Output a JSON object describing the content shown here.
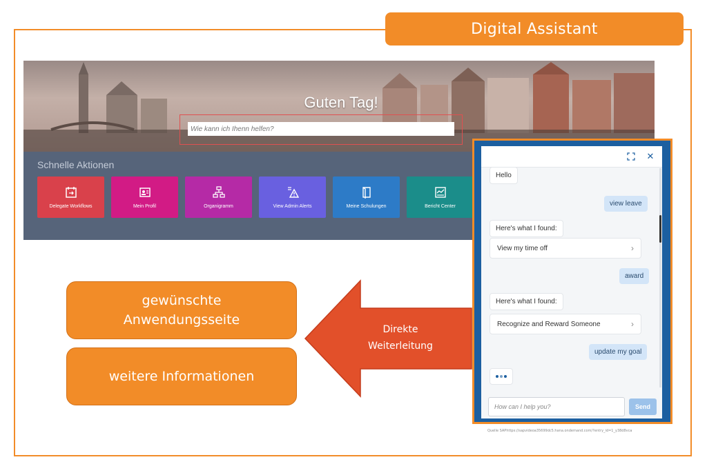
{
  "header": {
    "title": "Digital Assistant"
  },
  "portal": {
    "greeting": "Guten Tag!",
    "search_placeholder": "Wie kann ich Ihenn helfen?",
    "quick_actions_title": "Schnelle Aktionen",
    "tiles": [
      {
        "label": "Delegate Workflows",
        "color": "#d9414b",
        "icon": "delegate-icon"
      },
      {
        "label": "Mein Profil",
        "color": "#d21b85",
        "icon": "profile-icon"
      },
      {
        "label": "Organigramm",
        "color": "#b52aa6",
        "icon": "org-chart-icon"
      },
      {
        "label": "View Admin Alerts",
        "color": "#6960e0",
        "icon": "alert-icon"
      },
      {
        "label": "Meine Schulungen",
        "color": "#2d7bc7",
        "icon": "book-icon"
      },
      {
        "label": "Bericht Center",
        "color": "#1b8d8a",
        "icon": "report-icon"
      }
    ]
  },
  "chat": {
    "messages": [
      {
        "type": "bot",
        "text": "Hello"
      },
      {
        "type": "user",
        "text": "view leave"
      },
      {
        "type": "bot",
        "text": "Here's what I found:"
      },
      {
        "type": "card",
        "text": "View my time off"
      },
      {
        "type": "user",
        "text": "award"
      },
      {
        "type": "bot",
        "text": "Here's what I found:"
      },
      {
        "type": "card",
        "text": "Recognize and Reward Someone"
      },
      {
        "type": "user",
        "text": "update my goal"
      }
    ],
    "input_placeholder": "How can I help you?",
    "send_label": "Send"
  },
  "labels": {
    "target_page": "gewünschte Anwendungsseite",
    "more_info": "weitere Informationen",
    "arrow_text": "Direkte Weiterleitung"
  },
  "source": "Quelle SAPhttps://sapvideoa35699dc5.hana.ondemand.com/?entry_id=1_y38d8vca",
  "colors": {
    "accent": "#f28c28",
    "arrow": "#e2502a",
    "chat_frame": "#1c5fa0"
  }
}
